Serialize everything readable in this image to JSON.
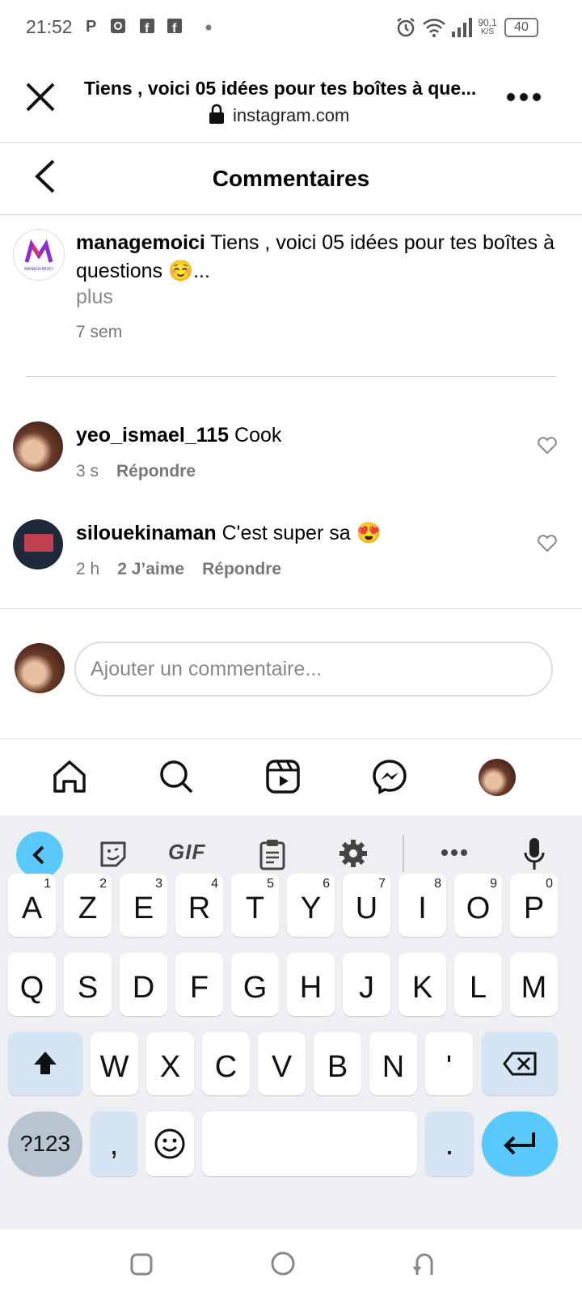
{
  "status_bar": {
    "time": "21:52",
    "net_speed_top": "90,1",
    "net_speed_bottom": "K/S",
    "battery": "40"
  },
  "browser": {
    "page_title": "Tiens , voici 05 idées pour tes boîtes à que...",
    "url": "instagram.com"
  },
  "header": {
    "title": "Commentaires"
  },
  "post": {
    "username": "managemoici",
    "text": "Tiens , voici 05 idées pour tes boîtes à questions ☺️...",
    "more": "plus",
    "age": "7 sem",
    "avatar_text": "MANAGEMOICI"
  },
  "comments": [
    {
      "username": "yeo_ismael_115",
      "text": "Cook",
      "age": "3 s",
      "likes": "",
      "reply": "Répondre"
    },
    {
      "username": "silouekinaman",
      "text": "C'est super sa 😍",
      "age": "2 h",
      "likes": "2 J’aime",
      "reply": "Répondre"
    }
  ],
  "composer": {
    "placeholder": "Ajouter un commentaire..."
  },
  "keyboard": {
    "toolbar": {
      "gif": "GIF"
    },
    "row1": [
      {
        "k": "A",
        "s": "1"
      },
      {
        "k": "Z",
        "s": "2"
      },
      {
        "k": "E",
        "s": "3"
      },
      {
        "k": "R",
        "s": "4"
      },
      {
        "k": "T",
        "s": "5"
      },
      {
        "k": "Y",
        "s": "6"
      },
      {
        "k": "U",
        "s": "7"
      },
      {
        "k": "I",
        "s": "8"
      },
      {
        "k": "O",
        "s": "9"
      },
      {
        "k": "P",
        "s": "0"
      }
    ],
    "row2": [
      "Q",
      "S",
      "D",
      "F",
      "G",
      "H",
      "J",
      "K",
      "L",
      "M"
    ],
    "row3": [
      "W",
      "X",
      "C",
      "V",
      "B",
      "N",
      "'"
    ],
    "symbols": "?123",
    "comma": ",",
    "period": "."
  },
  "colors": {
    "accent_blue": "#5ac8fa",
    "key_dark": "#d5e5f5"
  }
}
